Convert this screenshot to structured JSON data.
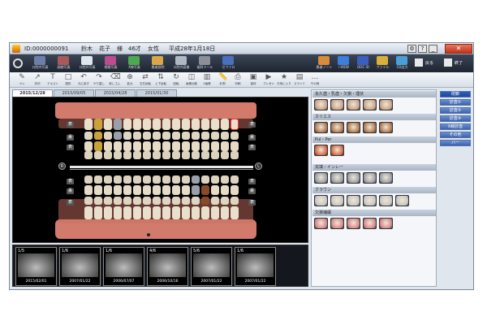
{
  "window": {
    "patient_id": "ID:0000000091",
    "surname": "鈴木",
    "given_name": "花子",
    "honorific": "様",
    "age": "46才",
    "sex": "女性",
    "date": "平成28年1月18日",
    "controls": {
      "help": "?",
      "minimize": "_",
      "maximize": "□",
      "close": "✕"
    }
  },
  "toolbar_main": {
    "items": [
      {
        "label": "口腔内写真",
        "color": "#6b7fa8"
      },
      {
        "label": "顔貌写真",
        "color": "#a85a5a"
      },
      {
        "label": "口腔外写真",
        "color": "#dfe6ee"
      },
      {
        "label": "規格写真",
        "color": "#c04a8f"
      },
      {
        "label": "X線写真",
        "color": "#4ea84e"
      },
      {
        "label": "患者説明",
        "color": "#d9a64a"
      },
      {
        "label": "口腔内画像",
        "color": "#b0b8c4"
      },
      {
        "label": "歯科ツール",
        "color": "#8a8f99"
      },
      {
        "label": "セファロ",
        "color": "#4a6fbf"
      }
    ],
    "right_items": [
      {
        "label": "患者ノート",
        "color": "#d98a3a"
      },
      {
        "label": "i-VIEW",
        "color": "#3a7fd9"
      },
      {
        "label": "DOC ID",
        "color": "#3a5fbf"
      },
      {
        "label": "ファイル",
        "color": "#d9b03a"
      },
      {
        "label": "CD出力",
        "color": "#4a9fd9"
      }
    ],
    "user_items": [
      {
        "label": "戻る"
      },
      {
        "label": "終了"
      }
    ]
  },
  "toolbar_tools": {
    "items": [
      {
        "label": "ペン",
        "icon": "pen-icon"
      },
      {
        "label": "矢印",
        "icon": "arrow-icon"
      },
      {
        "label": "テキスト",
        "icon": "text-icon"
      },
      {
        "label": "図形",
        "icon": "shape-icon"
      },
      {
        "label": "元に戻す",
        "icon": "undo-icon"
      },
      {
        "label": "やり直し",
        "icon": "redo-icon"
      },
      {
        "label": "消しゴム",
        "icon": "eraser-icon"
      },
      {
        "label": "拡大",
        "icon": "zoom-icon"
      },
      {
        "label": "左右反転",
        "icon": "flip-icon"
      },
      {
        "label": "上下反転",
        "icon": "flip-v-icon"
      },
      {
        "label": "回転",
        "icon": "rotate-icon"
      },
      {
        "label": "画像比較",
        "icon": "compare-icon"
      },
      {
        "label": "2画像",
        "icon": "two-image-icon"
      },
      {
        "label": "計測",
        "icon": "measure-icon"
      },
      {
        "label": "印刷",
        "icon": "print-icon"
      },
      {
        "label": "保存",
        "icon": "save-icon"
      },
      {
        "label": "プレゼン",
        "icon": "presentation-icon"
      },
      {
        "label": "お気に入り",
        "icon": "star-icon"
      },
      {
        "label": "スライド",
        "icon": "slide-icon"
      },
      {
        "label": "その他",
        "icon": "more-icon"
      }
    ]
  },
  "tabs": [
    {
      "label": "2015/12/28",
      "active": true
    },
    {
      "label": "2015/09/05",
      "active": false
    },
    {
      "label": "2015/04/28",
      "active": false
    },
    {
      "label": "2015/01/30",
      "active": false
    }
  ],
  "chart": {
    "row_labels_left": [
      "表",
      "裏",
      "表"
    ],
    "row_labels_right": [
      "表",
      "裏",
      "表"
    ],
    "row_labels_left_lower": [
      "表",
      "裏",
      "表"
    ],
    "row_labels_right_lower": [
      "表",
      "裏",
      "表"
    ],
    "side_right": "R",
    "side_left": "L"
  },
  "xrays": [
    {
      "count": "1/5",
      "date": "2015/02/01"
    },
    {
      "count": "1/6",
      "date": "2007/01/22"
    },
    {
      "count": "1/6",
      "date": "2006/07/07"
    },
    {
      "count": "4/6",
      "date": "2006/10/16"
    },
    {
      "count": "5/6",
      "date": "2007/01/22"
    },
    {
      "count": "1/6",
      "date": "2007/01/22"
    }
  ],
  "panel": {
    "sections": [
      {
        "title": "永久歯・乳歯・欠損・埋伏",
        "icons": 5,
        "color": "#c9a48a"
      },
      {
        "title": "カリエス",
        "icons": 5,
        "color": "#b07a55"
      },
      {
        "title": "Pul・Per",
        "icons": 2,
        "color": "#d46a4a"
      },
      {
        "title": "充填・インレー",
        "icons": 5,
        "color": "#9aa0aa"
      },
      {
        "title": "クラウン",
        "icons": 6,
        "color": "#c7c7c7"
      },
      {
        "title": "欠損補綴",
        "icons": 5,
        "color": "#d48a8a"
      }
    ]
  },
  "side_buttons": [
    {
      "label": "閉鎖"
    },
    {
      "label": "診査①"
    },
    {
      "label": "診査②"
    },
    {
      "label": "診査③"
    },
    {
      "label": "X線診査"
    },
    {
      "label": "その他"
    },
    {
      "label": "バー"
    }
  ]
}
